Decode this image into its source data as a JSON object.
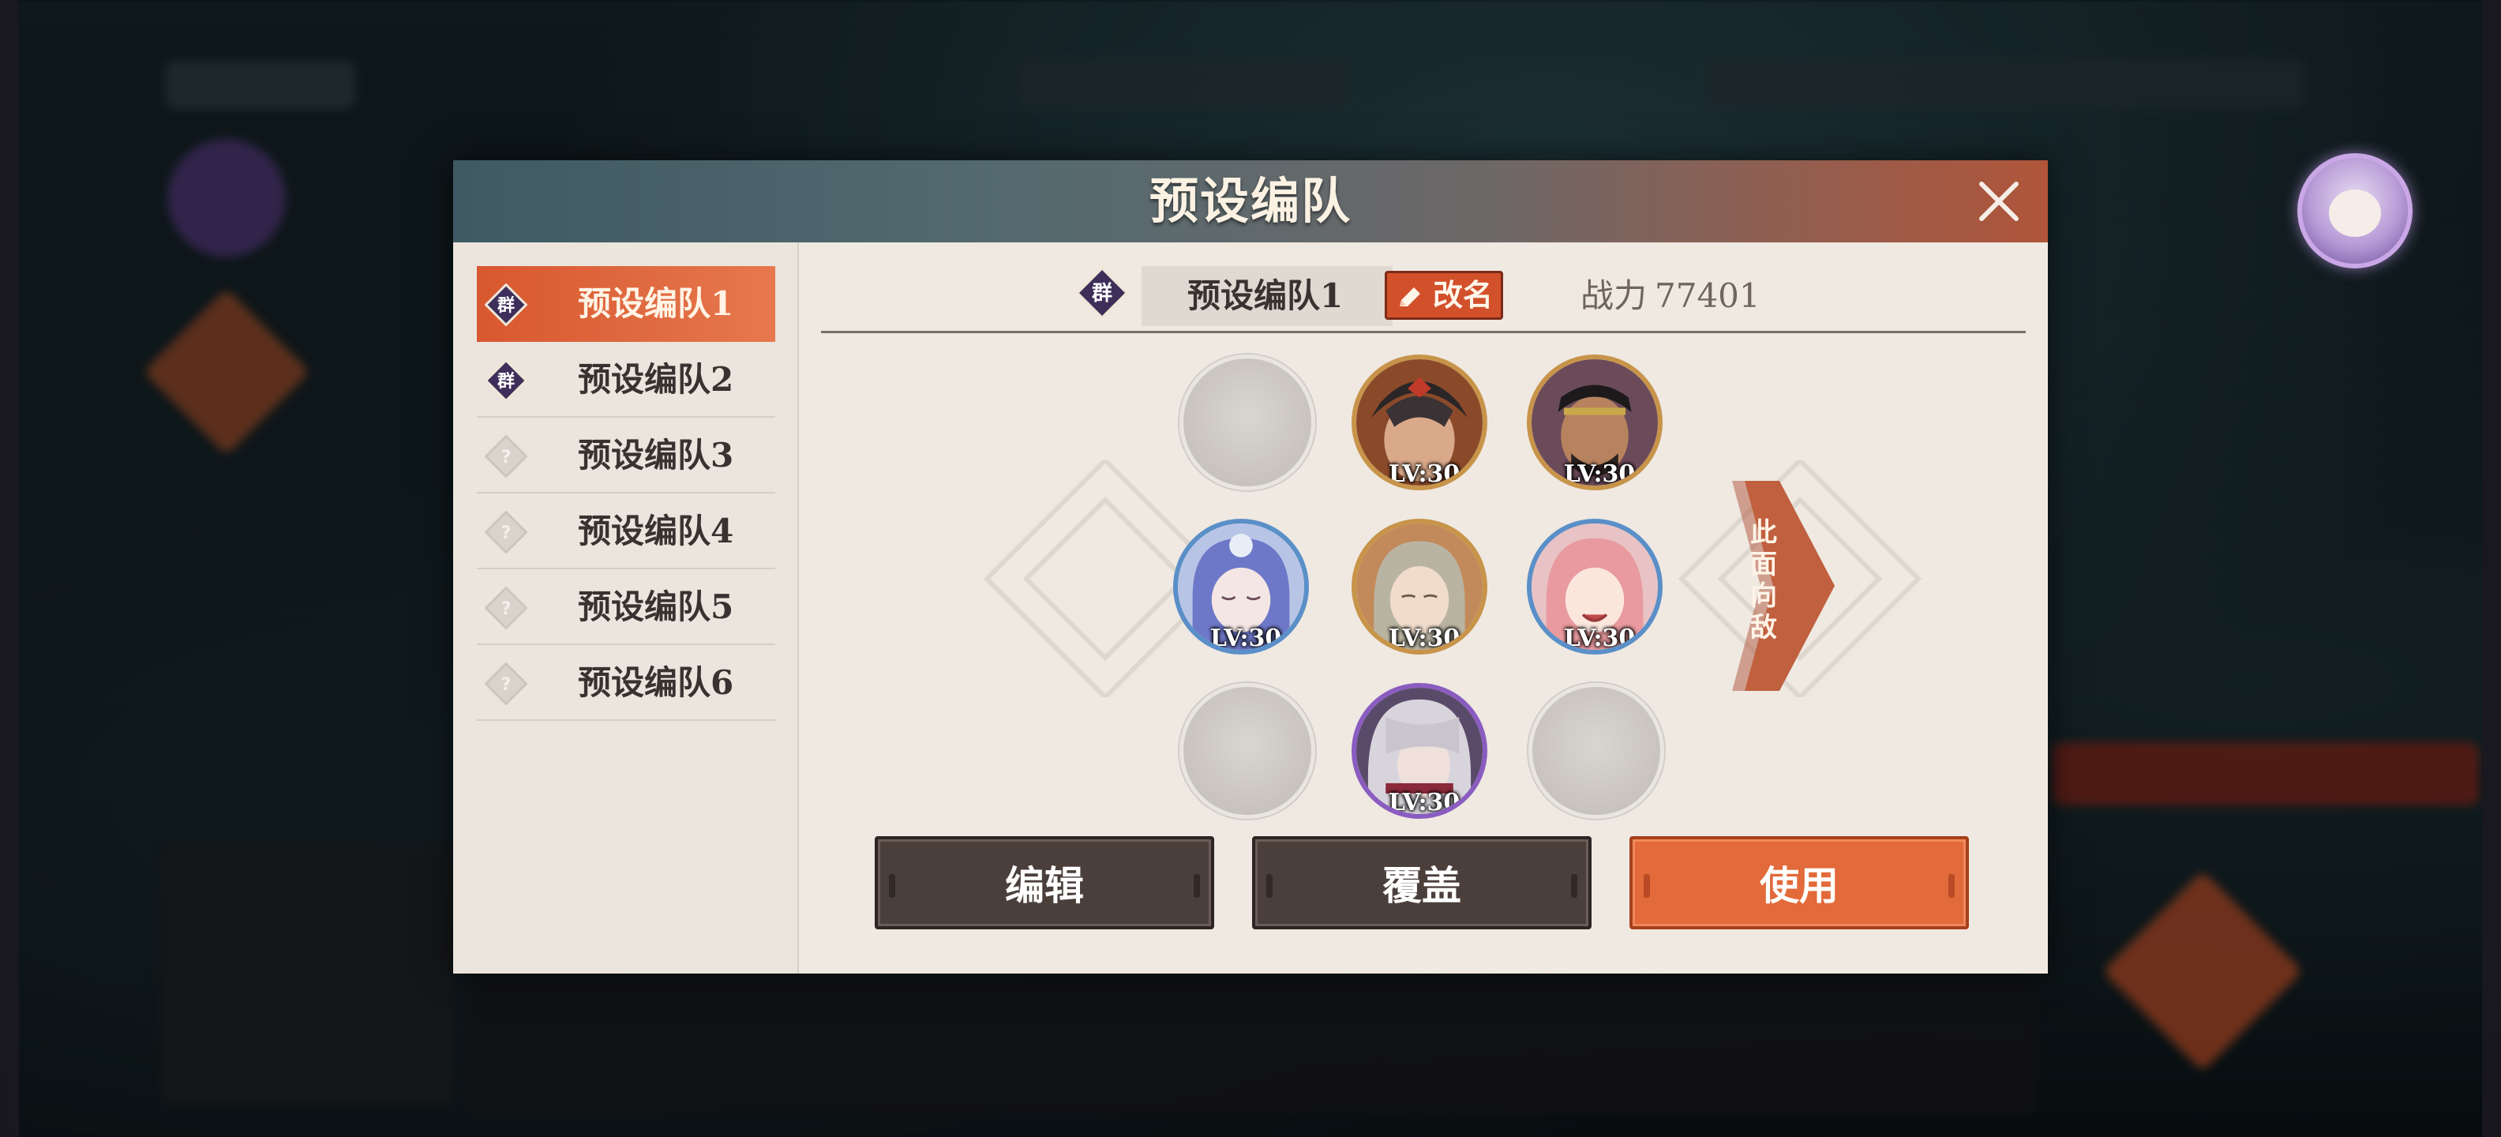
{
  "dialog": {
    "title": "预设编队",
    "close_icon": "close-icon"
  },
  "sidebar": {
    "items": [
      {
        "label": "预设编队1",
        "badge": "群",
        "badge_icon": "faction-diamond-icon",
        "active": true
      },
      {
        "label": "预设编队2",
        "badge": "群",
        "badge_icon": "faction-diamond-icon",
        "active": false
      },
      {
        "label": "预设编队3",
        "badge": "?",
        "badge_icon": "question-diamond-icon",
        "active": false
      },
      {
        "label": "预设编队4",
        "badge": "?",
        "badge_icon": "question-diamond-icon",
        "active": false
      },
      {
        "label": "预设编队5",
        "badge": "?",
        "badge_icon": "question-diamond-icon",
        "active": false
      },
      {
        "label": "预设编队6",
        "badge": "?",
        "badge_icon": "question-diamond-icon",
        "active": false
      }
    ]
  },
  "team": {
    "badge": "群",
    "name": "预设编队1",
    "rename_label": "改名",
    "power_label": "战力",
    "power_value": "77401"
  },
  "formation": {
    "facing_label": "此面向敌",
    "slots": [
      {
        "row": 1,
        "col": 1,
        "empty": true
      },
      {
        "row": 1,
        "col": 2,
        "empty": false,
        "level": "LV:30"
      },
      {
        "row": 1,
        "col": 3,
        "empty": false,
        "level": "LV:30"
      },
      {
        "row": 2,
        "col": 1,
        "empty": false,
        "level": "LV:30"
      },
      {
        "row": 2,
        "col": 2,
        "empty": false,
        "level": "LV:30"
      },
      {
        "row": 2,
        "col": 3,
        "empty": false,
        "level": "LV:30"
      },
      {
        "row": 3,
        "col": 1,
        "empty": true
      },
      {
        "row": 3,
        "col": 2,
        "empty": false,
        "level": "LV:30"
      },
      {
        "row": 3,
        "col": 3,
        "empty": true
      }
    ]
  },
  "actions": {
    "edit_label": "编辑",
    "overwrite_label": "覆盖",
    "use_label": "使用"
  },
  "colors": {
    "accent": "#d8582f",
    "use_button": "#e36a3a",
    "dark_button": "#4a3f3b",
    "panel": "#efe9e2"
  }
}
